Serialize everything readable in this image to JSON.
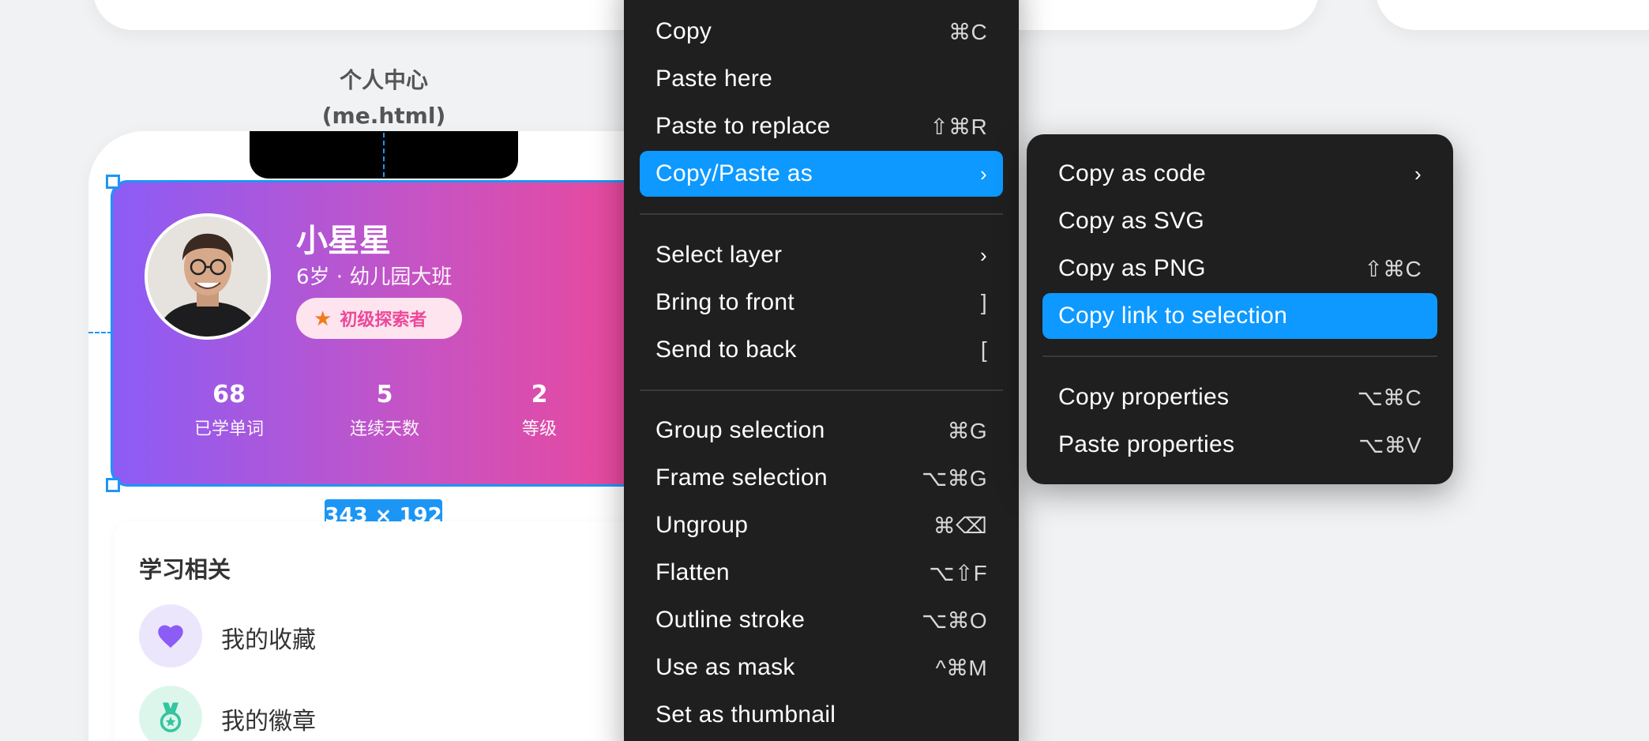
{
  "frame": {
    "label_line1": "个人中心",
    "label_line2": "(me.html)",
    "selection_size": "343 × 192"
  },
  "profile": {
    "name": "小星星",
    "subtitle": "6岁 · 幼儿园大班",
    "badge": "初级探索者",
    "stats": [
      {
        "value": "68",
        "label": "已学单词"
      },
      {
        "value": "5",
        "label": "连续天数"
      },
      {
        "value": "2",
        "label": "等级"
      }
    ]
  },
  "learning": {
    "title": "学习相关",
    "items": [
      {
        "label": "我的收藏",
        "icon": "heart-icon"
      },
      {
        "label": "我的徽章",
        "icon": "medal-icon"
      }
    ]
  },
  "context_menu": {
    "items": [
      {
        "label": "Copy",
        "shortcut": "⌘C"
      },
      {
        "label": "Paste here",
        "shortcut": ""
      },
      {
        "label": "Paste to replace",
        "shortcut": "⇧⌘R"
      },
      {
        "label": "Copy/Paste as",
        "shortcut": "›",
        "active": true
      },
      {
        "label": "Select layer",
        "shortcut": "›"
      },
      {
        "label": "Bring to front",
        "shortcut": "]"
      },
      {
        "label": "Send to back",
        "shortcut": "["
      },
      {
        "label": "Group selection",
        "shortcut": "⌘G"
      },
      {
        "label": "Frame selection",
        "shortcut": "⌥⌘G"
      },
      {
        "label": "Ungroup",
        "shortcut": "⌘⌫"
      },
      {
        "label": "Flatten",
        "shortcut": "⌥⇧F"
      },
      {
        "label": "Outline stroke",
        "shortcut": "⌥⌘O"
      },
      {
        "label": "Use as mask",
        "shortcut": "^⌘M"
      },
      {
        "label": "Set as thumbnail",
        "shortcut": ""
      }
    ]
  },
  "submenu": {
    "items": [
      {
        "label": "Copy as code",
        "shortcut": "›"
      },
      {
        "label": "Copy as SVG",
        "shortcut": ""
      },
      {
        "label": "Copy as PNG",
        "shortcut": "⇧⌘C"
      },
      {
        "label": "Copy link to selection",
        "shortcut": "",
        "active": true
      },
      {
        "label": "Copy properties",
        "shortcut": "⌥⌘C"
      },
      {
        "label": "Paste properties",
        "shortcut": "⌥⌘V"
      }
    ]
  },
  "colors": {
    "selection_blue": "#1c96f5",
    "menu_bg": "#1f1f1f",
    "menu_active": "#0d99ff",
    "card_gradient_start": "#8b5cf6",
    "card_gradient_end": "#ec4899"
  }
}
